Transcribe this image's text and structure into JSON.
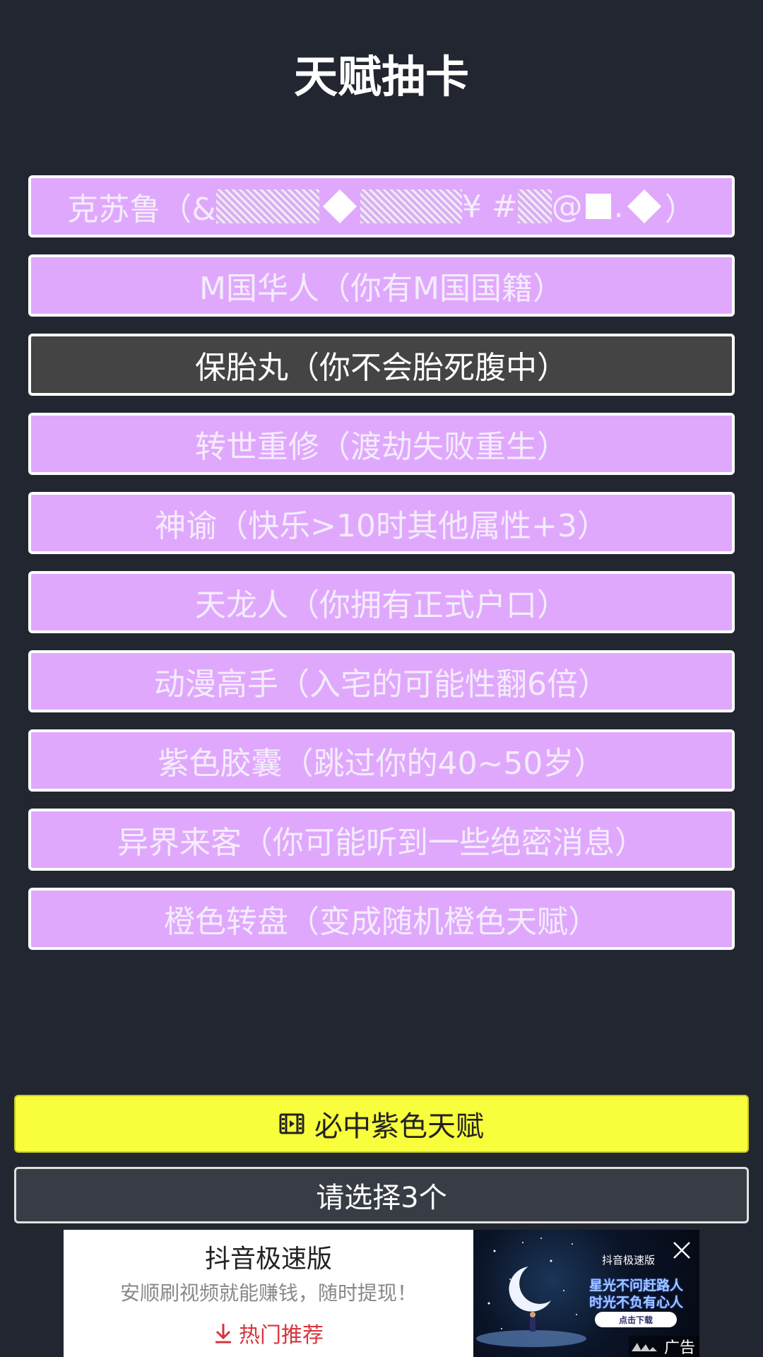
{
  "page": {
    "title": "天赋抽卡"
  },
  "talents": [
    {
      "prefix": "克苏鲁（&",
      "mid1": "¥ #",
      "mid2": "@",
      "mid3": ".",
      "suffix": "）",
      "selected": false
    },
    {
      "label": "M国华人（你有M国国籍）",
      "selected": false
    },
    {
      "label": "保胎丸（你不会胎死腹中）",
      "selected": true
    },
    {
      "label": "转世重修（渡劫失败重生）",
      "selected": false
    },
    {
      "label": "神谕（快乐>10时其他属性+3）",
      "selected": false
    },
    {
      "label": "天龙人（你拥有正式户口）",
      "selected": false
    },
    {
      "label": "动漫高手（入宅的可能性翻6倍）",
      "selected": false
    },
    {
      "label": "紫色胶囊（跳过你的40~50岁）",
      "selected": false
    },
    {
      "label": "异界来客（你可能听到一些绝密消息）",
      "selected": false
    },
    {
      "label": "橙色转盘（变成随机橙色天赋）",
      "selected": false
    }
  ],
  "actions": {
    "guarantee_label": "必中紫色天赋",
    "guarantee_icon": "film-icon",
    "choose_label": "请选择3个"
  },
  "ad": {
    "app_name": "抖音极速版",
    "description": "安顺刷视频就能赚钱，随时提现！",
    "cta_label": "热门推荐",
    "cta_icon": "download-arrow-icon",
    "image_brand": "抖音极速版",
    "image_slogan_1": "星光不问赶路人",
    "image_slogan_2": "时光不负有心人",
    "image_button": "点击下载",
    "close_icon": "close-icon",
    "ad_label": "广告"
  },
  "colors": {
    "background": "#212631",
    "talent_purple": "#dfa8fd",
    "talent_selected": "#444444",
    "guarantee_button": "#f8fd3c",
    "choose_button": "#383c45",
    "cta_red": "#d6343d"
  }
}
